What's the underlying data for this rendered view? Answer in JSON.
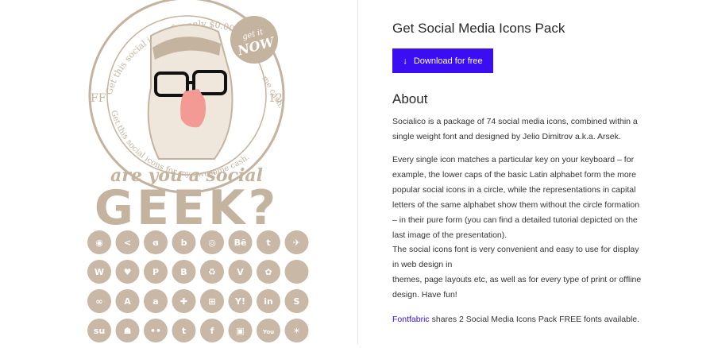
{
  "poster": {
    "arc_top_text": "Get this social icons for only $0.00 and save",
    "arc_right_text": "me cash.",
    "arc_bottom_text": "Get this social icons for my awesome cash.",
    "badge_line1": "get it",
    "badge_line2": "NOW",
    "left_label": "FF",
    "right_label": "12",
    "tagline": "are you a social",
    "headline": "GEEK?"
  },
  "icons": [
    {
      "name": "rss-icon",
      "glyph": "◉"
    },
    {
      "name": "share-icon",
      "glyph": "<"
    },
    {
      "name": "bebo-icon",
      "glyph": "ɞ"
    },
    {
      "name": "blogger-b-icon",
      "glyph": "b"
    },
    {
      "name": "circular-icon",
      "glyph": "◎"
    },
    {
      "name": "behance-icon",
      "glyph": "Bē"
    },
    {
      "name": "tumblr-icon",
      "glyph": "t"
    },
    {
      "name": "gowalla-icon",
      "glyph": "✈"
    },
    {
      "name": "wordpress-icon",
      "glyph": "W"
    },
    {
      "name": "heart-icon",
      "glyph": "♥"
    },
    {
      "name": "paypal-icon",
      "glyph": "P"
    },
    {
      "name": "blogger-icon",
      "glyph": "B"
    },
    {
      "name": "recycle-icon",
      "glyph": "♻"
    },
    {
      "name": "vimeo-icon",
      "glyph": "V"
    },
    {
      "name": "qik-icon",
      "glyph": "✿"
    },
    {
      "name": "apple-icon",
      "glyph": ""
    },
    {
      "name": "lastfm-icon",
      "glyph": "∞"
    },
    {
      "name": "appstore-icon",
      "glyph": "A"
    },
    {
      "name": "amazon-icon",
      "glyph": "a"
    },
    {
      "name": "plus-icon",
      "glyph": "✚"
    },
    {
      "name": "windows-icon",
      "glyph": "⊞"
    },
    {
      "name": "yahoo-icon",
      "glyph": "Y!"
    },
    {
      "name": "linkedin-icon",
      "glyph": "in"
    },
    {
      "name": "skype-icon",
      "glyph": "S"
    },
    {
      "name": "stumbleupon-icon",
      "glyph": "su"
    },
    {
      "name": "myspace-icon",
      "glyph": "☗"
    },
    {
      "name": "flickr-icon",
      "glyph": "••"
    },
    {
      "name": "twitter-icon",
      "glyph": "t"
    },
    {
      "name": "facebook-icon",
      "glyph": "f"
    },
    {
      "name": "tumblr-square-icon",
      "glyph": "▣"
    },
    {
      "name": "youtube-icon",
      "glyph": "You"
    },
    {
      "name": "lastfm-figure-icon",
      "glyph": "✶"
    },
    {
      "name": "chat-icon",
      "glyph": "💬"
    }
  ],
  "details": {
    "title": "Get Social Media Icons Pack",
    "download_label": "Download for free",
    "about_heading": "About",
    "paragraph1": "Socialico is a package of 74 social media icons, combined within a single weight font and designed by Jelio Dimitrov a.k.a. Arsek.",
    "paragraph2": "Every single icon matches a particular key on your keyboard – for example, the lower caps of the basic Latin alphabet form the more popular social icons in a circle, while the representations in capital letters of the same alphabet show them without the circle formation – in their pure form (you can find a detailed tutorial depicted on the last image of the presentation).",
    "paragraph3_line1": "The social icons font is very convenient and easy to use for display in web design in",
    "paragraph3_line2": "themes, page layouts etc, as well as for every type of print or offline design. Have fun!",
    "publisher_link": "Fontfabric",
    "publisher_text": " shares 2 Social Media Icons Pack FREE fonts available."
  },
  "colors": {
    "accent": "#3b0df2",
    "poster_beige": "#c4b39f",
    "nose_pink": "#f29a93"
  }
}
